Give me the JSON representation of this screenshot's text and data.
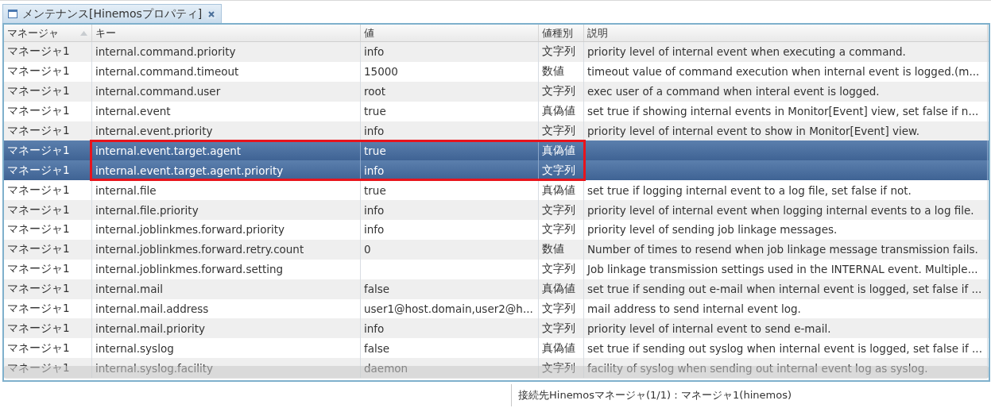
{
  "tab": {
    "title": "メンテナンス[Hinemosプロパティ]"
  },
  "table": {
    "columns": [
      {
        "label": "マネージャ",
        "sorted": true
      },
      {
        "label": "キー",
        "sorted": false
      },
      {
        "label": "値",
        "sorted": false
      },
      {
        "label": "値種別",
        "sorted": false
      },
      {
        "label": "説明",
        "sorted": false
      }
    ],
    "rows": [
      {
        "manager": "マネージャ1",
        "key": "internal.command.priority",
        "value": "info",
        "type": "文字列",
        "description": "priority level of internal event when executing a command.",
        "selected": false,
        "highlighted": false
      },
      {
        "manager": "マネージャ1",
        "key": "internal.command.timeout",
        "value": "15000",
        "type": "数値",
        "description": "timeout value of command execution when internal event  is logged.(m...",
        "selected": false,
        "highlighted": false
      },
      {
        "manager": "マネージャ1",
        "key": "internal.command.user",
        "value": "root",
        "type": "文字列",
        "description": "exec user of a command when interal event is logged.",
        "selected": false,
        "highlighted": false
      },
      {
        "manager": "マネージャ1",
        "key": "internal.event",
        "value": "true",
        "type": "真偽値",
        "description": "set true if showing internal events in Monitor[Event] view, set false if n...",
        "selected": false,
        "highlighted": false
      },
      {
        "manager": "マネージャ1",
        "key": "internal.event.priority",
        "value": "info",
        "type": "文字列",
        "description": "priority level of internal event to show in Monitor[Event] view.",
        "selected": false,
        "highlighted": false
      },
      {
        "manager": "マネージャ1",
        "key": "internal.event.target.agent",
        "value": "true",
        "type": "真偽値",
        "description": "",
        "selected": true,
        "highlighted": true
      },
      {
        "manager": "マネージャ1",
        "key": "internal.event.target.agent.priority",
        "value": "info",
        "type": "文字列",
        "description": "",
        "selected": true,
        "highlighted": true
      },
      {
        "manager": "マネージャ1",
        "key": "internal.file",
        "value": "true",
        "type": "真偽値",
        "description": "set true if logging internal event to a log file, set false if not.",
        "selected": false,
        "highlighted": false
      },
      {
        "manager": "マネージャ1",
        "key": "internal.file.priority",
        "value": "info",
        "type": "文字列",
        "description": "priority level of internal event when logging internal events to a log file.",
        "selected": false,
        "highlighted": false
      },
      {
        "manager": "マネージャ1",
        "key": "internal.joblinkmes.forward.priority",
        "value": "info",
        "type": "文字列",
        "description": "priority level of sending job linkage messages.",
        "selected": false,
        "highlighted": false
      },
      {
        "manager": "マネージャ1",
        "key": "internal.joblinkmes.forward.retry.count",
        "value": "0",
        "type": "数値",
        "description": "Number of times to resend when job linkage message transmission fails.",
        "selected": false,
        "highlighted": false
      },
      {
        "manager": "マネージャ1",
        "key": "internal.joblinkmes.forward.setting",
        "value": "",
        "type": "文字列",
        "description": "Job linkage transmission settings used in the INTERNAL event. Multiple...",
        "selected": false,
        "highlighted": false
      },
      {
        "manager": "マネージャ1",
        "key": "internal.mail",
        "value": "false",
        "type": "真偽値",
        "description": "set true if sending out e-mail when internal event is logged, set false if ...",
        "selected": false,
        "highlighted": false
      },
      {
        "manager": "マネージャ1",
        "key": "internal.mail.address",
        "value": "user1@host.domain,user2@h...",
        "type": "文字列",
        "description": "mail address to send internal event log.",
        "selected": false,
        "highlighted": false
      },
      {
        "manager": "マネージャ1",
        "key": "internal.mail.priority",
        "value": "info",
        "type": "文字列",
        "description": "priority level of internal event to send e-mail.",
        "selected": false,
        "highlighted": false
      },
      {
        "manager": "マネージャ1",
        "key": "internal.syslog",
        "value": "false",
        "type": "真偽値",
        "description": "set true if sending out syslog when internal event is logged, set false if ...",
        "selected": false,
        "highlighted": false
      },
      {
        "manager": "マネージャ1",
        "key": "internal.syslog.facility",
        "value": "daemon",
        "type": "文字列",
        "description": "facility of syslog when sending out internal event log as syslog.",
        "selected": false,
        "highlighted": false
      }
    ]
  },
  "status_bar": {
    "text": "接続先Hinemosマネージャ(1/1)：マネージャ1(hinemos)"
  }
}
